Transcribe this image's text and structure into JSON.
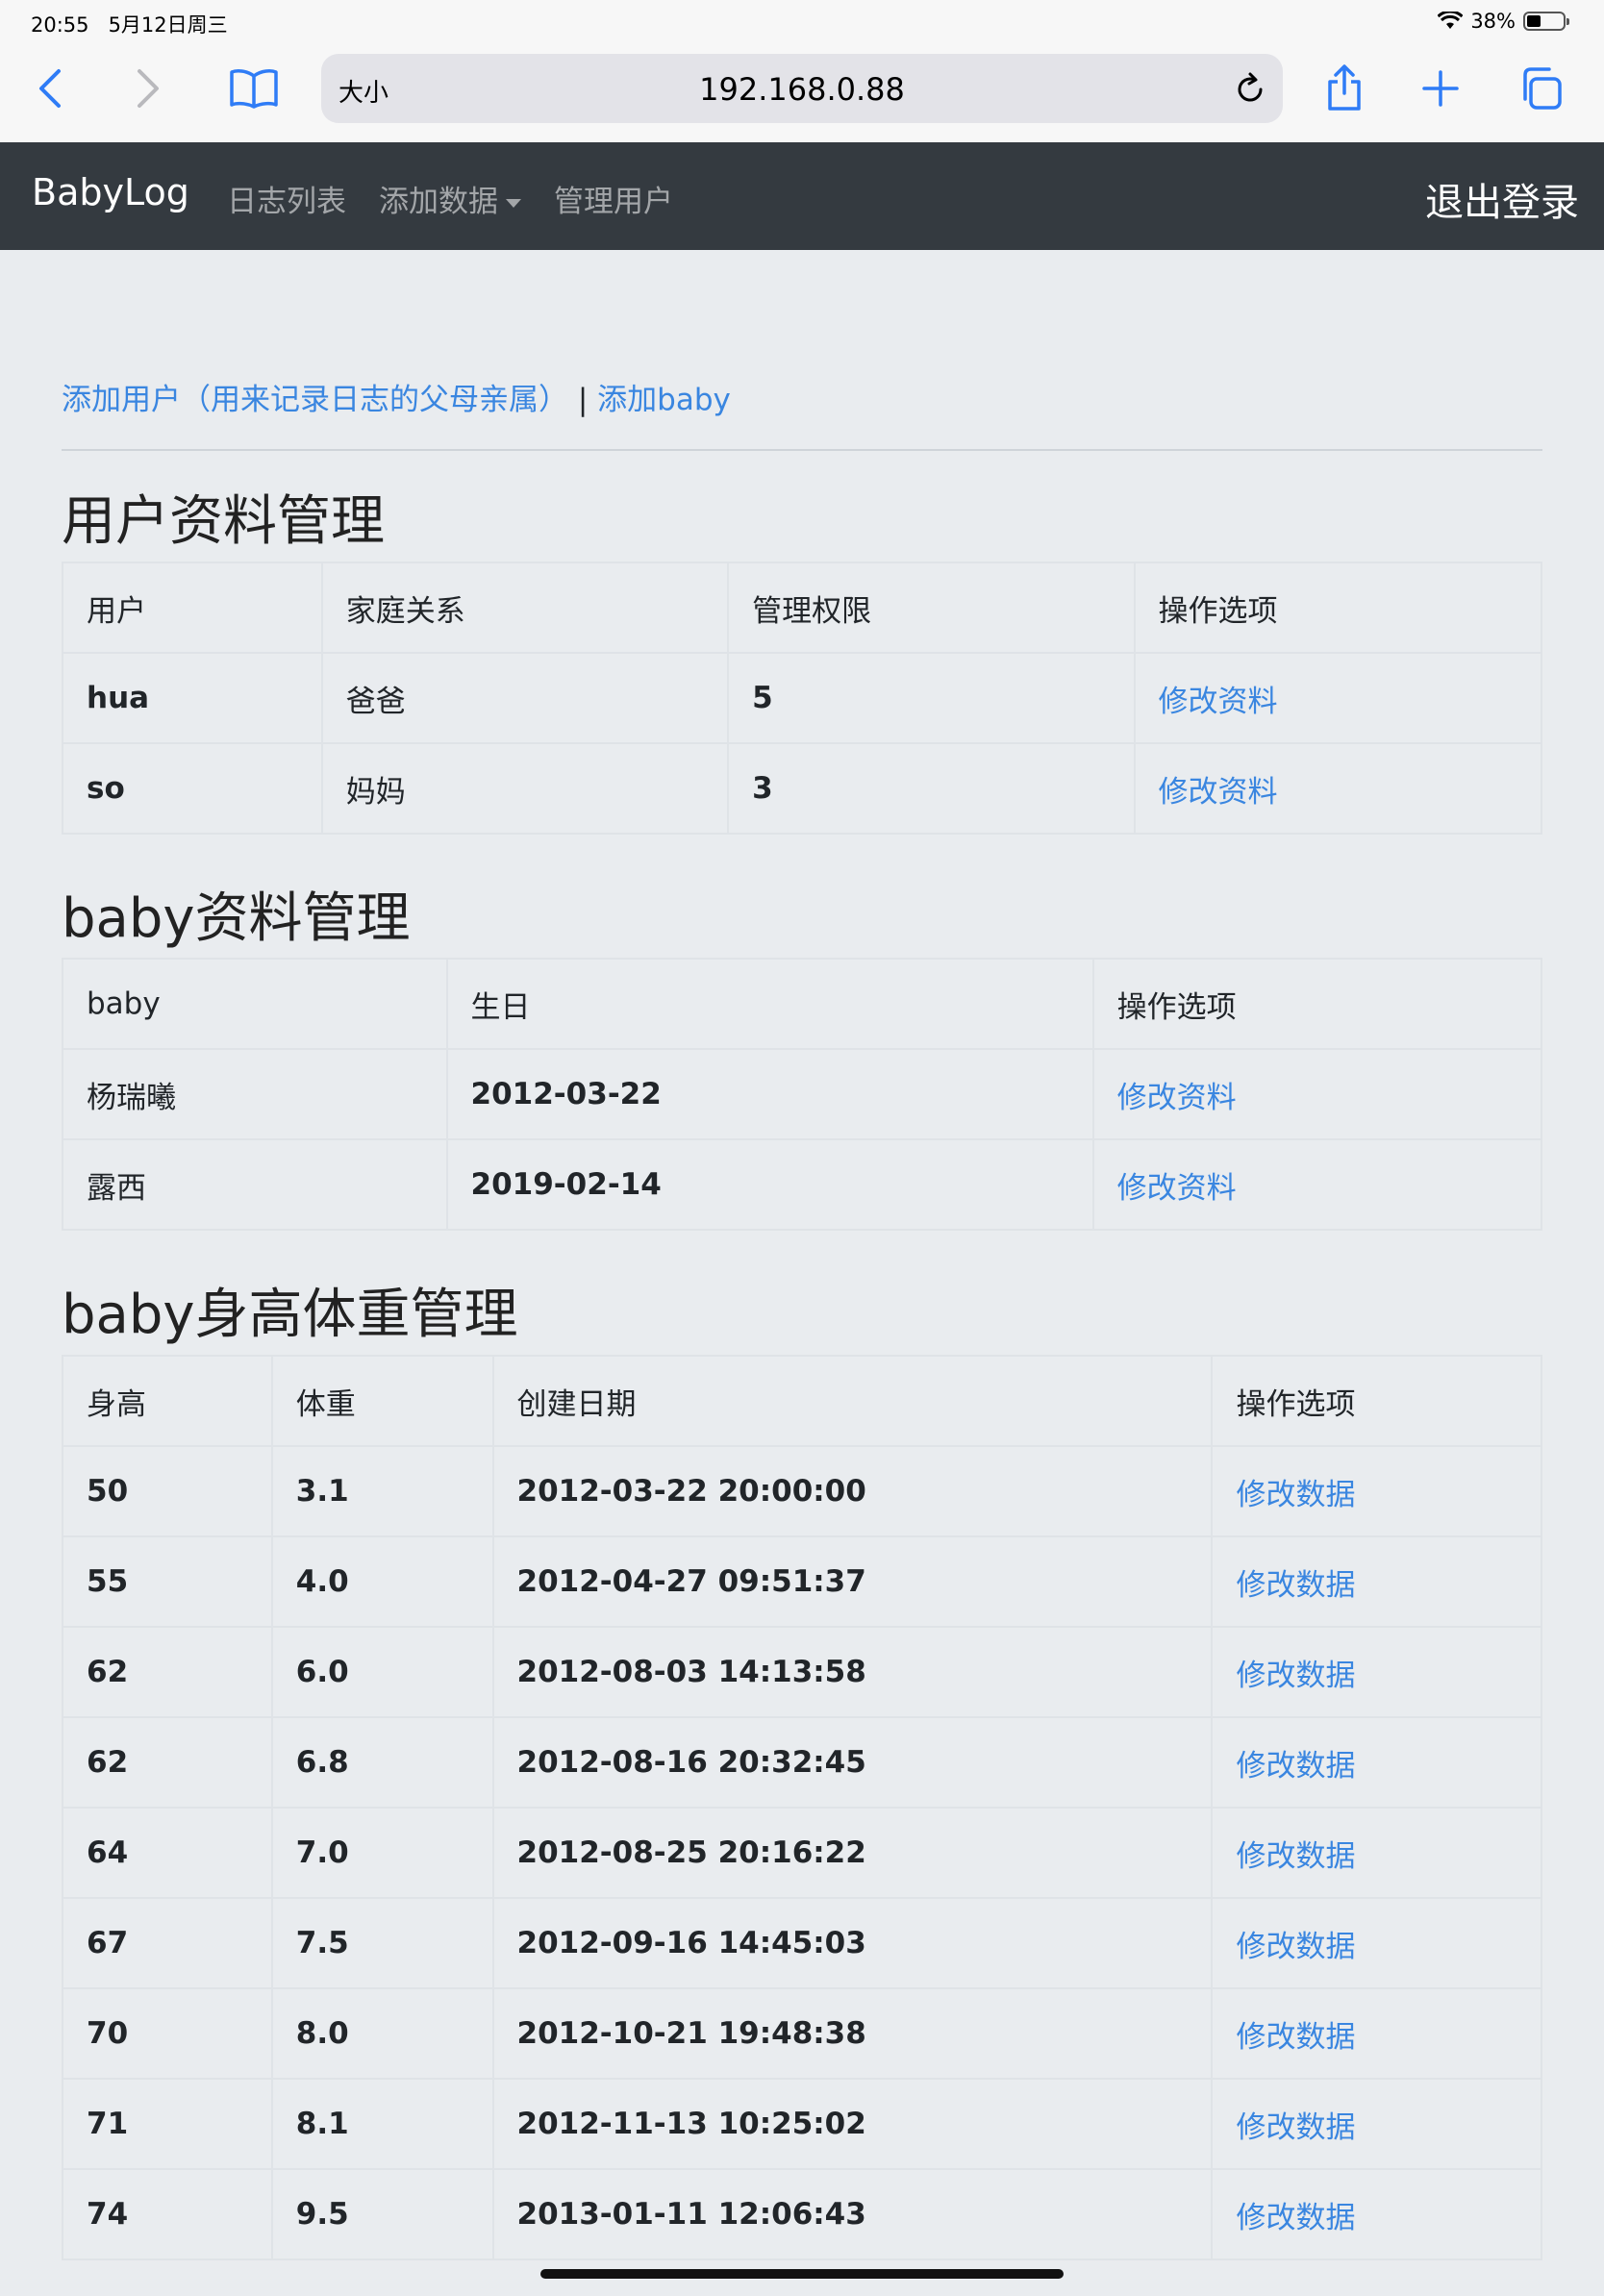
{
  "status": {
    "time": "20:55",
    "date": "5月12日周三",
    "battery": "38%",
    "battery_level": 0.38
  },
  "browser": {
    "text_size_label": "大小",
    "url": "192.168.0.88"
  },
  "navbar": {
    "brand": "BabyLog",
    "links": [
      "日志列表",
      "添加数据",
      "管理用户"
    ],
    "logout": "退出登录"
  },
  "actions": {
    "add_user": "添加用户（用来记录日志的父母亲属）",
    "separator": "|",
    "add_baby": "添加baby"
  },
  "users": {
    "title": "用户资料管理",
    "headers": [
      "用户",
      "家庭关系",
      "管理权限",
      "操作选项"
    ],
    "rows": [
      [
        "hua",
        "爸爸",
        "5",
        "修改资料"
      ],
      [
        "so",
        "妈妈",
        "3",
        "修改资料"
      ]
    ]
  },
  "babies": {
    "title": "baby资料管理",
    "headers": [
      "baby",
      "生日",
      "操作选项"
    ],
    "rows": [
      [
        "杨瑞曦",
        "2012-03-22",
        "修改资料"
      ],
      [
        "露西",
        "2019-02-14",
        "修改资料"
      ]
    ]
  },
  "growth": {
    "title": "baby身高体重管理",
    "headers": [
      "身高",
      "体重",
      "创建日期",
      "操作选项"
    ],
    "rows": [
      [
        "50",
        "3.1",
        "2012-03-22 20:00:00",
        "修改数据"
      ],
      [
        "55",
        "4.0",
        "2012-04-27 09:51:37",
        "修改数据"
      ],
      [
        "62",
        "6.0",
        "2012-08-03 14:13:58",
        "修改数据"
      ],
      [
        "62",
        "6.8",
        "2012-08-16 20:32:45",
        "修改数据"
      ],
      [
        "64",
        "7.0",
        "2012-08-25 20:16:22",
        "修改数据"
      ],
      [
        "67",
        "7.5",
        "2012-09-16 14:45:03",
        "修改数据"
      ],
      [
        "70",
        "8.0",
        "2012-10-21 19:48:38",
        "修改数据"
      ],
      [
        "71",
        "8.1",
        "2012-11-13 10:25:02",
        "修改数据"
      ],
      [
        "74",
        "9.5",
        "2013-01-11 12:06:43",
        "修改数据"
      ]
    ]
  }
}
